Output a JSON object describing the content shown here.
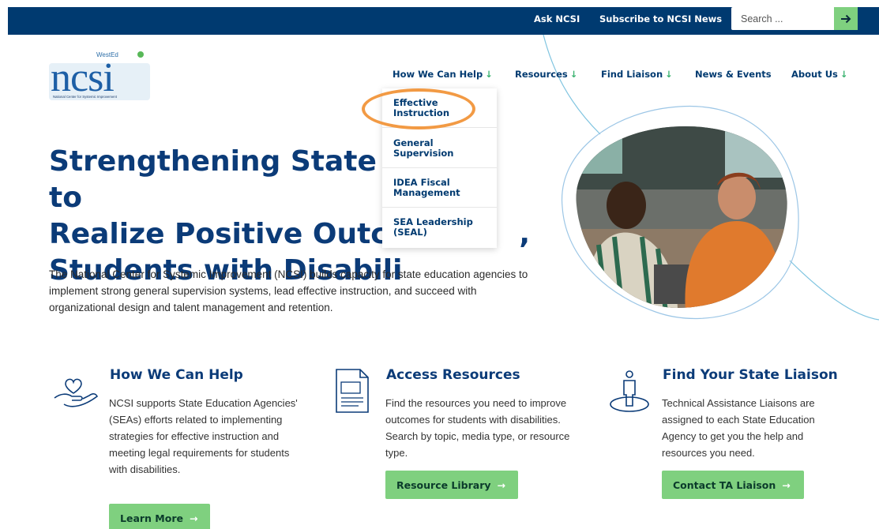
{
  "topbar": {
    "ask_label": "Ask NCSI",
    "subscribe_label": "Subscribe to NCSI News",
    "search_placeholder": "Search ...",
    "search_button_icon": "arrow-right-icon"
  },
  "logo": {
    "brand_top": "WestEd",
    "name": "ncsi",
    "subtitle": "National Center for Systemic Improvement"
  },
  "nav": {
    "items": [
      {
        "label": "How We Can Help",
        "arrow": "↓"
      },
      {
        "label": "Resources",
        "arrow": "↓"
      },
      {
        "label": "Find Liaison",
        "arrow": "↓"
      },
      {
        "label": "News & Events",
        "arrow": ""
      },
      {
        "label": "About Us",
        "arrow": "↓"
      }
    ]
  },
  "dropdown": {
    "items": [
      {
        "line1": "Effective",
        "line2": "Instruction"
      },
      {
        "line1": "General",
        "line2": "Supervision"
      },
      {
        "line1": "IDEA Fiscal",
        "line2": "Management"
      },
      {
        "line1": "SEA Leadership",
        "line2": "(SEAL)"
      }
    ]
  },
  "hero": {
    "line1": "Strengthening State C",
    "line1b": "to",
    "line2": "Realize Positive Outco",
    "line2b": ",",
    "line3": "Students with Disabili",
    "text": "The National Center for Systemic Improvement (NCSI) builds capacity for state education agencies to implement strong general supervision systems, lead effective instruction, and succeed with organizational design and talent management and retention."
  },
  "features": [
    {
      "icon": "heart-hand-icon",
      "title": "How We Can Help",
      "text": "NCSI supports State Education Agencies' (SEAs) efforts related to implementing strategies for effective instruction and meeting legal requirements for students with disabilities.",
      "button": "Learn More"
    },
    {
      "icon": "document-icon",
      "title": "Access Resources",
      "text": "Find the resources you need to improve outcomes for students with disabilities. Search by topic, media type, or resource type.",
      "button": "Resource Library"
    },
    {
      "icon": "person-icon",
      "title": "Find Your State Liaison",
      "text": "Technical Assistance Liaisons are assigned to each State Education Agency to get you the help and resources you need.",
      "button": "Contact TA Liaison"
    }
  ],
  "colors": {
    "navy": "#003a70",
    "title_blue": "#0b3b78",
    "green": "#7fd07f",
    "highlight": "#f29a44"
  }
}
